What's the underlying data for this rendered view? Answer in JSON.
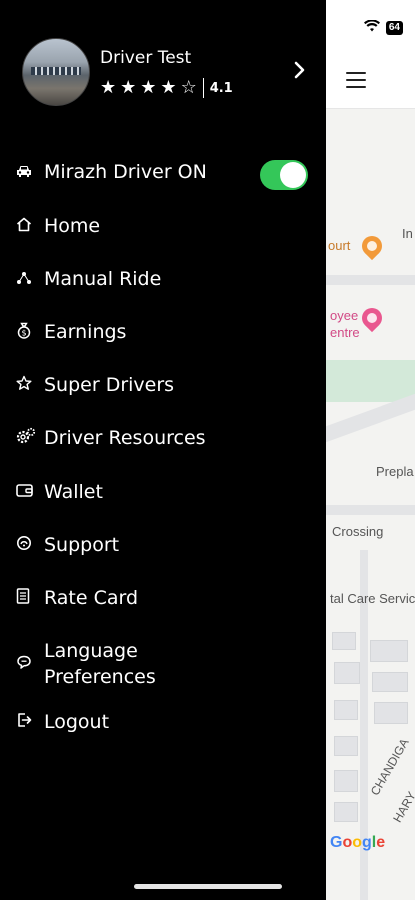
{
  "status": {
    "battery": "64"
  },
  "map_labels": {
    "court": "ourt",
    "in": "In",
    "employee": "oyee",
    "centre": "entre",
    "prepla": "Prepla",
    "crossing": "Crossing",
    "care": "tal Care Servic",
    "chandig": "CHANDIGA",
    "hary": "HARY",
    "google": [
      "G",
      "o",
      "o",
      "g",
      "l",
      "e"
    ]
  },
  "profile": {
    "name": "Driver Test",
    "rating": "4.1",
    "stars_filled": 4,
    "stars_total": 5
  },
  "menu": {
    "status_toggle": {
      "label": "Mirazh Driver ON",
      "on": true
    },
    "items": [
      {
        "label": "Home"
      },
      {
        "label": "Manual Ride"
      },
      {
        "label": "Earnings"
      },
      {
        "label": "Super Drivers"
      },
      {
        "label": "Driver Resources"
      },
      {
        "label": "Wallet"
      },
      {
        "label": "Support"
      },
      {
        "label": "Rate Card"
      },
      {
        "label": "Language\nPreferences"
      },
      {
        "label": "Logout"
      }
    ]
  },
  "colors": {
    "toggle_on": "#34c759",
    "drawer_bg": "#000000"
  },
  "icons": [
    "car-icon",
    "home-icon",
    "share-icon",
    "money-bag-icon",
    "star-icon",
    "gears-icon",
    "wallet-icon",
    "support-icon",
    "document-icon",
    "chat-icon",
    "logout-icon",
    "menu-icon",
    "wifi-icon"
  ]
}
